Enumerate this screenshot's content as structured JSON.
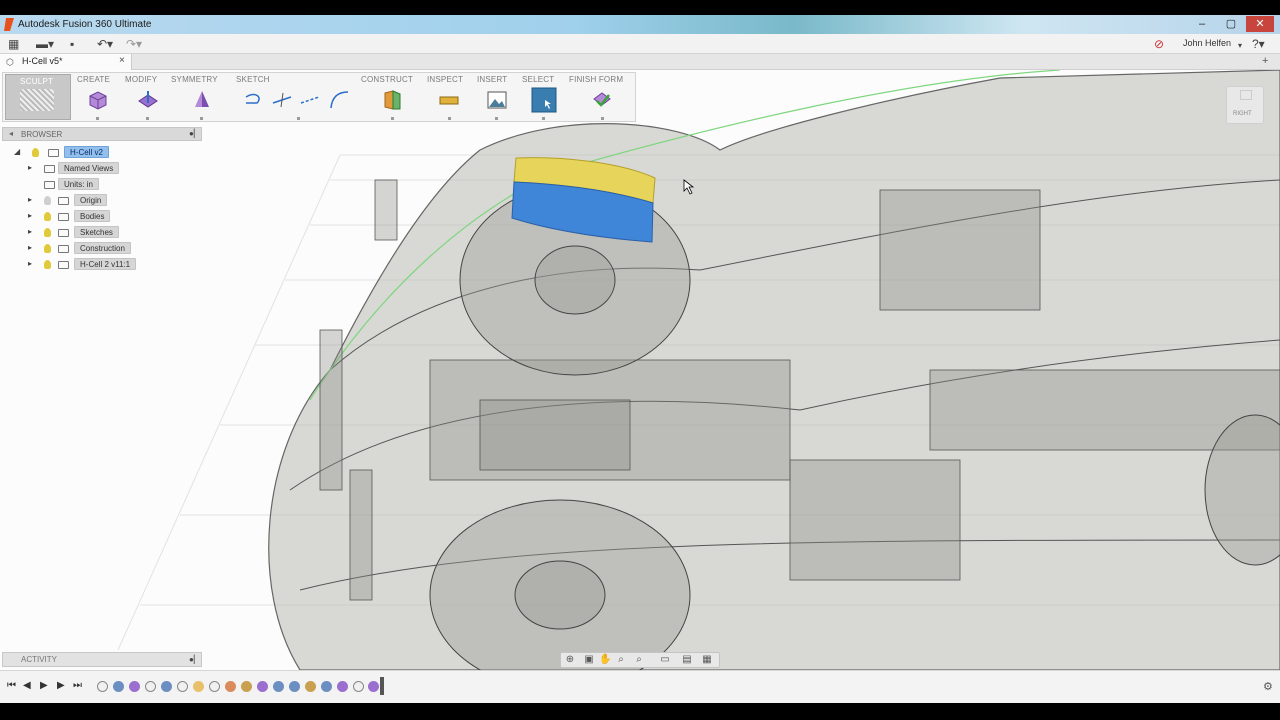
{
  "window": {
    "title": "Autodesk Fusion 360 Ultimate",
    "controls": {
      "minimize": "–",
      "maximize": "▢",
      "close": "✕"
    }
  },
  "quick_access": {
    "user_name": "John Helfen",
    "icons": [
      "grid-icon",
      "file-icon",
      "save-icon",
      "undo-icon",
      "redo-icon",
      "stop-icon",
      "help-icon"
    ]
  },
  "document_tab": {
    "label": "H-Cell v5*",
    "close": "×"
  },
  "ribbon": {
    "mode": "SCULPT",
    "groups": [
      {
        "label": "CREATE",
        "icon": "box-icon"
      },
      {
        "label": "MODIFY",
        "icon": "edit-form-icon"
      },
      {
        "label": "SYMMETRY",
        "icon": "mirror-icon"
      },
      {
        "label": "SKETCH",
        "icon": "sketch-icon"
      },
      {
        "label": "CONSTRUCT",
        "icon": "plane-icon"
      },
      {
        "label": "INSPECT",
        "icon": "measure-icon"
      },
      {
        "label": "INSERT",
        "icon": "image-icon"
      },
      {
        "label": "SELECT",
        "icon": "select-icon"
      },
      {
        "label": "FINISH FORM",
        "icon": "finish-icon"
      }
    ]
  },
  "browser": {
    "title": "BROWSER",
    "nodes": [
      {
        "label": "H-Cell v2",
        "active": true
      },
      {
        "label": "Named Views"
      },
      {
        "label": "Units: in"
      },
      {
        "label": "Origin"
      },
      {
        "label": "Bodies"
      },
      {
        "label": "Sketches"
      },
      {
        "label": "Construction"
      },
      {
        "label": "H-Cell 2 v11:1"
      }
    ]
  },
  "activity": {
    "title": "ACTIVITY"
  },
  "viewcube": {
    "face": "RIGHT"
  },
  "colors": {
    "selected_face_top": "#e6d55a",
    "selected_face_bottom": "#3f86d9",
    "active_node": "#93bfec",
    "green_edge": "#7ed67e"
  },
  "timeline": {
    "controls": [
      "⏮",
      "◀",
      "▶",
      "▶",
      "⏭"
    ]
  }
}
